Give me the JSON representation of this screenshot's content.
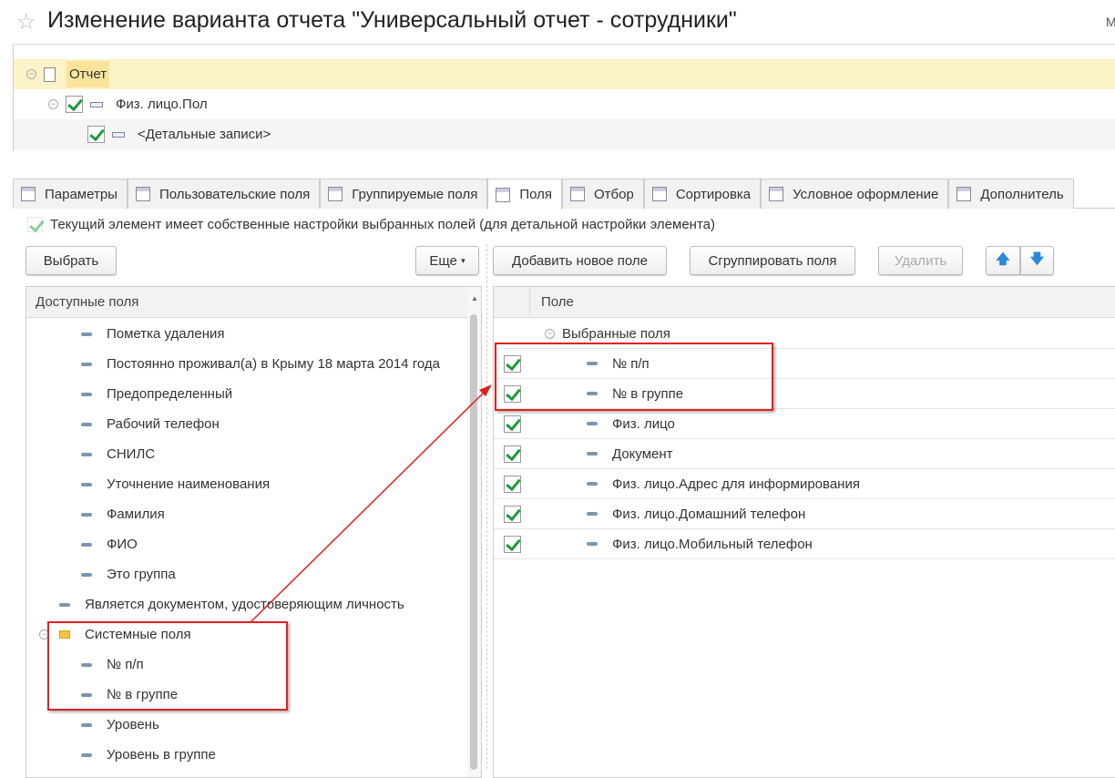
{
  "title": "Изменение варианта отчета \"Универсальный отчет - сотрудники\"",
  "top_right": "М",
  "structure": [
    {
      "label": "Отчет"
    },
    {
      "label": "Физ. лицо.Пол",
      "checked": true
    },
    {
      "label": "<Детальные записи>",
      "checked": true
    }
  ],
  "tabs": [
    {
      "label": "Параметры"
    },
    {
      "label": "Пользовательские поля"
    },
    {
      "label": "Группируемые поля"
    },
    {
      "label": "Поля",
      "active": true
    },
    {
      "label": "Отбор"
    },
    {
      "label": "Сортировка"
    },
    {
      "label": "Условное оформление"
    },
    {
      "label": "Дополнитель"
    }
  ],
  "own_settings_label": "Текущий элемент имеет собственные настройки выбранных полей (для детальной настройки элемента)",
  "buttons": {
    "select": "Выбрать",
    "more": "Еще",
    "add_field": "Добавить новое поле",
    "group_fields": "Сгруппировать поля",
    "delete": "Удалить"
  },
  "available": {
    "header": "Доступные поля",
    "items": [
      {
        "label": "Пометка удаления",
        "level": 2
      },
      {
        "label": "Постоянно проживал(а) в Крыму 18 марта 2014 года",
        "level": 2
      },
      {
        "label": "Предопределенный",
        "level": 2
      },
      {
        "label": "Рабочий телефон",
        "level": 2
      },
      {
        "label": "СНИЛС",
        "level": 2
      },
      {
        "label": "Уточнение наименования",
        "level": 2
      },
      {
        "label": "Фамилия",
        "level": 2
      },
      {
        "label": "ФИО",
        "level": 2
      },
      {
        "label": "Это группа",
        "level": 2
      },
      {
        "label": "Является документом, удостоверяющим личность",
        "level": 1
      },
      {
        "label": "Системные поля",
        "level": 1,
        "folder": true
      },
      {
        "label": "№ п/п",
        "level": 2
      },
      {
        "label": "№ в группе",
        "level": 2
      },
      {
        "label": "Уровень",
        "level": 2
      },
      {
        "label": "Уровень в группе",
        "level": 2
      }
    ]
  },
  "selected": {
    "header": "Поле",
    "root": "Выбранные поля",
    "items": [
      {
        "label": "№ п/п",
        "checked": true
      },
      {
        "label": "№ в группе",
        "checked": true
      },
      {
        "label": "Физ. лицо",
        "checked": true
      },
      {
        "label": "Документ",
        "checked": true
      },
      {
        "label": "Физ. лицо.Адрес для информирования",
        "checked": true
      },
      {
        "label": "Физ. лицо.Домашний телефон",
        "checked": true
      },
      {
        "label": "Физ. лицо.Мобильный телефон",
        "checked": true
      }
    ]
  }
}
